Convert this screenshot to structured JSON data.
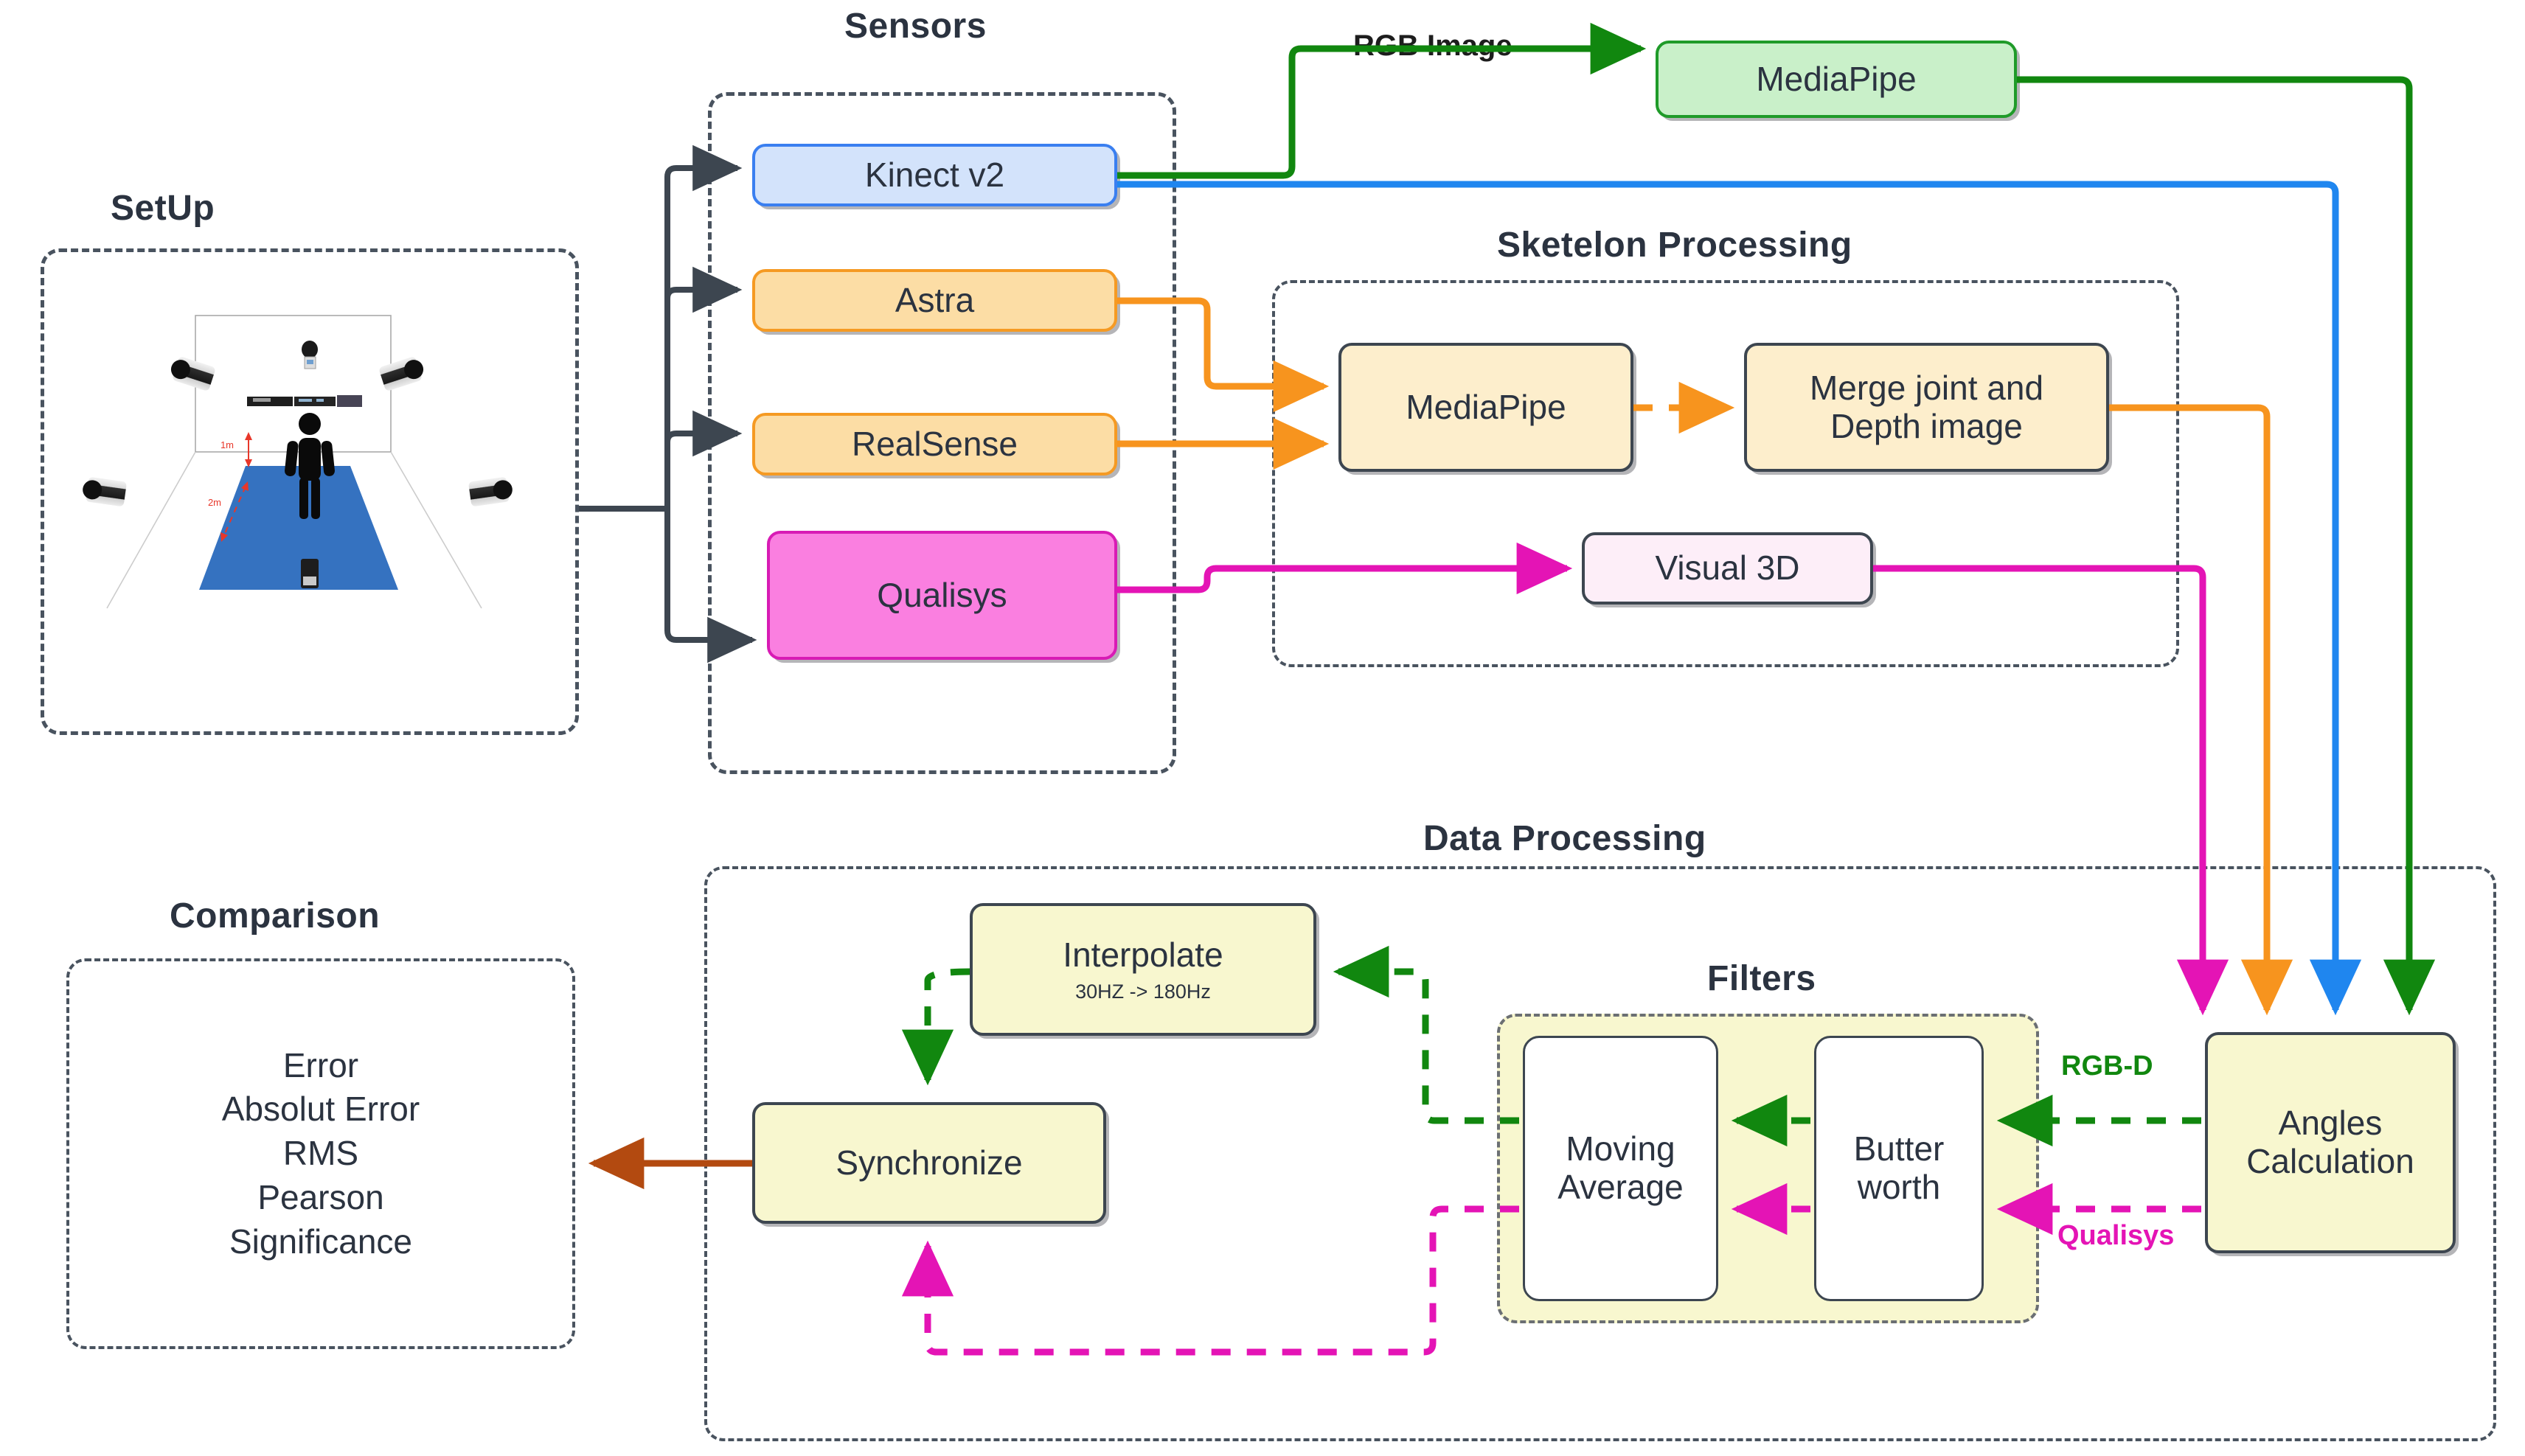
{
  "groups": {
    "setup": {
      "title": "SetUp"
    },
    "sensors": {
      "title": "Sensors"
    },
    "skeleton": {
      "title": "Sketelon Processing"
    },
    "data_processing": {
      "title": "Data Processing"
    },
    "filters": {
      "title": "Filters"
    },
    "comparison": {
      "title": "Comparison"
    }
  },
  "setup": {
    "distance_near": "1m",
    "distance_far": "2m"
  },
  "sensors": {
    "kinect": "Kinect v2",
    "astra": "Astra",
    "realsense": "RealSense",
    "qualisys": "Qualisys"
  },
  "skeleton": {
    "mediapipe": "MediaPipe",
    "merge": "Merge joint and\nDepth image",
    "merge_line1": "Merge joint and",
    "merge_line2": "Depth image",
    "visual3d": "Visual 3D"
  },
  "top": {
    "mediapipe": "MediaPipe",
    "rgb_image_label": "RGB Image"
  },
  "processing": {
    "interpolate_title": "Interpolate",
    "interpolate_sub": "30HZ -> 180Hz",
    "synchronize": "Synchronize",
    "moving_average_line1": "Moving",
    "moving_average_line2": "Average",
    "butterworth_line1": "Butter",
    "butterworth_line2": "worth",
    "angles_line1": "Angles",
    "angles_line2": "Calculation",
    "rgbd_label": "RGB-D",
    "qualisys_label": "Qualisys"
  },
  "comparison": {
    "metrics": [
      "Error",
      "Absolut Error",
      "RMS",
      "Pearson",
      "Significance"
    ]
  },
  "colors": {
    "kinect_fill": "#d3e3fb",
    "kinect_stroke": "#3a7ff0",
    "astra_fill": "#fcdda5",
    "astra_stroke": "#f59a23",
    "qualisys_fill": "#fa7fe0",
    "qualisys_stroke": "#d81bb5",
    "cream_fill": "#fdeecc",
    "pink_fill": "#fdeef8",
    "yellow_fill": "#f8f7cf",
    "green_fill": "#c9f0c9",
    "green_stroke": "#1f9b29",
    "dark_stroke": "#3d4650",
    "flow_green": "#11870f",
    "flow_orange": "#f7941e",
    "flow_blue": "#1f86ef",
    "flow_magenta": "#e414b5",
    "flow_brown": "#b34a10",
    "flow_red": "#e8372a"
  }
}
